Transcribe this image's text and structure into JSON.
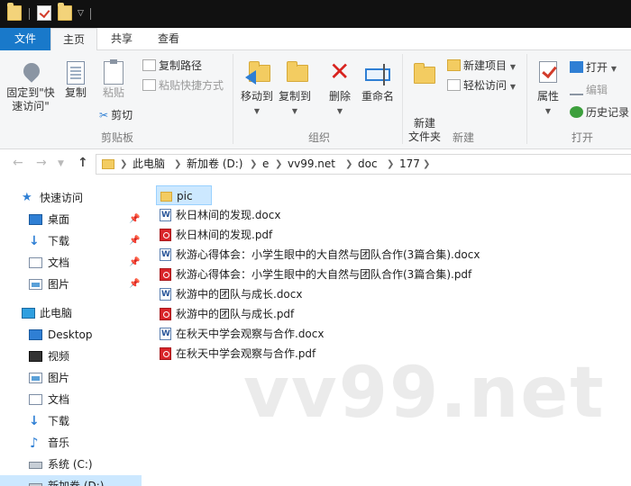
{
  "ribbon_tabs": {
    "file": "文件",
    "home": "主页",
    "share": "共享",
    "view": "查看"
  },
  "clipboard": {
    "pin_label": "固定到\"快速访问\"",
    "copy_label": "复制",
    "paste_label": "粘贴",
    "copy_path": "复制路径",
    "paste_shortcut": "粘贴快捷方式",
    "cut": "剪切",
    "group_label": "剪贴板"
  },
  "organize": {
    "move_to": "移动到",
    "copy_to": "复制到",
    "delete": "删除",
    "rename": "重命名",
    "group_label": "组织"
  },
  "new_group": {
    "new_folder": "新建\n文件夹",
    "new_item": "新建项目",
    "easy_access": "轻松访问",
    "group_label": "新建"
  },
  "open_group": {
    "properties": "属性",
    "open": "打开",
    "edit": "编辑",
    "history": "历史记录",
    "group_label": "打开"
  },
  "address": {
    "crumbs": [
      "此电脑",
      "新加卷 (D:)",
      "e",
      "vv99.net",
      "doc",
      "177"
    ]
  },
  "nav_pane": {
    "quick_access": "快速访问",
    "desktop": "桌面",
    "downloads": "下载",
    "documents": "文档",
    "pictures": "图片",
    "this_pc": "此电脑",
    "pc_desktop": "Desktop",
    "videos": "视频",
    "pc_pictures": "图片",
    "pc_documents": "文档",
    "pc_downloads": "下载",
    "music": "音乐",
    "drive_c": "系统 (C:)",
    "drive_d": "新加卷 (D:)"
  },
  "files": [
    {
      "name": "pic",
      "type": "folder"
    },
    {
      "name": "秋日林间的发现.docx",
      "type": "docx"
    },
    {
      "name": "秋日林间的发现.pdf",
      "type": "pdf"
    },
    {
      "name": "秋游心得体会：小学生眼中的大自然与团队合作(3篇合集).docx",
      "type": "docx"
    },
    {
      "name": "秋游心得体会：小学生眼中的大自然与团队合作(3篇合集).pdf",
      "type": "pdf"
    },
    {
      "name": "秋游中的团队与成长.docx",
      "type": "docx"
    },
    {
      "name": "秋游中的团队与成长.pdf",
      "type": "pdf"
    },
    {
      "name": "在秋天中学会观察与合作.docx",
      "type": "docx"
    },
    {
      "name": "在秋天中学会观察与合作.pdf",
      "type": "pdf"
    }
  ],
  "watermark": "vv99.net",
  "colors": {
    "accent": "#1979ca",
    "selection": "#cce8ff",
    "folder": "#f3cc61",
    "pdf": "#d9252a"
  }
}
